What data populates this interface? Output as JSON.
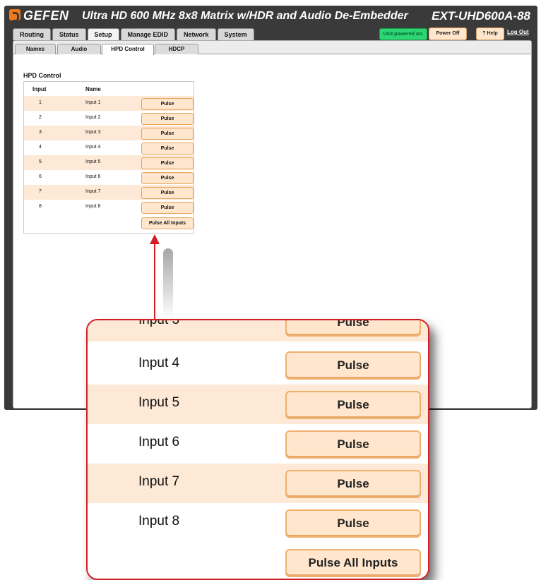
{
  "header": {
    "logo": "GEFEN",
    "product_title": "Ultra HD 600 MHz 8x8 Matrix w/HDR and Audio De-Embedder",
    "model": "EXT-UHD600A-88",
    "status": "Unit powered on.",
    "power_off_label": "Power Off",
    "help_label": "? Help",
    "logout_label": "Log Out"
  },
  "main_tabs": [
    "Routing",
    "Status",
    "Setup",
    "Manage EDID",
    "Network",
    "System"
  ],
  "active_main_tab": "Setup",
  "sub_tabs": [
    "Names",
    "Audio",
    "HPD Control",
    "HDCP"
  ],
  "active_sub_tab": "HPD Control",
  "hpd": {
    "title": "HPD Control",
    "col_input": "Input",
    "col_name": "Name",
    "rows": [
      {
        "num": "1",
        "name": "Input 1",
        "action": "Pulse"
      },
      {
        "num": "2",
        "name": "Input 2",
        "action": "Pulse"
      },
      {
        "num": "3",
        "name": "Input 3",
        "action": "Pulse"
      },
      {
        "num": "4",
        "name": "Input 4",
        "action": "Pulse"
      },
      {
        "num": "5",
        "name": "Input 5",
        "action": "Pulse"
      },
      {
        "num": "6",
        "name": "Input 6",
        "action": "Pulse"
      },
      {
        "num": "7",
        "name": "Input 7",
        "action": "Pulse"
      },
      {
        "num": "8",
        "name": "Input 8",
        "action": "Pulse"
      }
    ],
    "pulse_all_label": "Pulse All Inputs"
  },
  "colors": {
    "accent_orange": "#f07a1a",
    "button_fill": "#ffe6cc",
    "row_shade": "#fde9d6",
    "status_green": "#2ed573",
    "callout_red": "#d21f26"
  }
}
